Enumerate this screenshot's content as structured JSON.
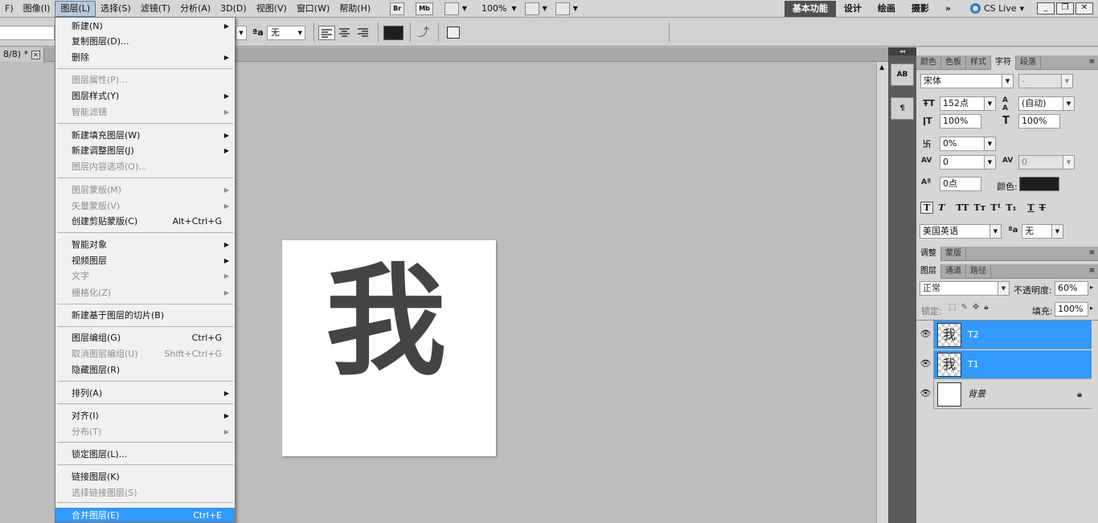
{
  "menubar": {
    "items": [
      "F)",
      "图像(I)",
      "图层(L)",
      "选择(S)",
      "滤镜(T)",
      "分析(A)",
      "3D(D)",
      "视图(V)",
      "窗口(W)",
      "帮助(H)"
    ],
    "bridge_label": "Br",
    "minibridge_label": "Mb",
    "zoom": "100%",
    "workspaces": [
      "基本功能",
      "设计",
      "绘画",
      "摄影",
      "»"
    ],
    "cs_live": "CS Live"
  },
  "optbar": {
    "aa_label": "a",
    "aa_value": "无"
  },
  "doctab": {
    "title": "8/8) *"
  },
  "dropdown": {
    "items": [
      {
        "label": "新建(N)",
        "sc": "",
        "sub": true,
        "dis": false
      },
      {
        "label": "复制图层(D)...",
        "sc": "",
        "sub": false,
        "dis": false
      },
      {
        "label": "删除",
        "sc": "",
        "sub": true,
        "dis": false
      },
      {
        "label": "图层属性(P)...",
        "sc": "",
        "sub": false,
        "dis": true
      },
      {
        "label": "图层样式(Y)",
        "sc": "",
        "sub": true,
        "dis": false
      },
      {
        "label": "智能滤镜",
        "sc": "",
        "sub": true,
        "dis": true
      },
      {
        "label": "新建填充图层(W)",
        "sc": "",
        "sub": true,
        "dis": false
      },
      {
        "label": "新建调整图层(J)",
        "sc": "",
        "sub": true,
        "dis": false
      },
      {
        "label": "图层内容选项(O)...",
        "sc": "",
        "sub": false,
        "dis": true
      },
      {
        "label": "图层蒙版(M)",
        "sc": "",
        "sub": true,
        "dis": true
      },
      {
        "label": "矢量蒙版(V)",
        "sc": "",
        "sub": true,
        "dis": true
      },
      {
        "label": "创建剪贴蒙版(C)",
        "sc": "Alt+Ctrl+G",
        "sub": false,
        "dis": false
      },
      {
        "label": "智能对象",
        "sc": "",
        "sub": true,
        "dis": false
      },
      {
        "label": "视频图层",
        "sc": "",
        "sub": true,
        "dis": false
      },
      {
        "label": "文字",
        "sc": "",
        "sub": true,
        "dis": true
      },
      {
        "label": "栅格化(Z)",
        "sc": "",
        "sub": true,
        "dis": true
      },
      {
        "label": "新建基于图层的切片(B)",
        "sc": "",
        "sub": false,
        "dis": false
      },
      {
        "label": "图层编组(G)",
        "sc": "Ctrl+G",
        "sub": false,
        "dis": false
      },
      {
        "label": "取消图层编组(U)",
        "sc": "Shift+Ctrl+G",
        "sub": false,
        "dis": true
      },
      {
        "label": "隐藏图层(R)",
        "sc": "",
        "sub": false,
        "dis": false
      },
      {
        "label": "排列(A)",
        "sc": "",
        "sub": true,
        "dis": false
      },
      {
        "label": "对齐(I)",
        "sc": "",
        "sub": true,
        "dis": false
      },
      {
        "label": "分布(T)",
        "sc": "",
        "sub": true,
        "dis": true
      },
      {
        "label": "锁定图层(L)...",
        "sc": "",
        "sub": false,
        "dis": false
      },
      {
        "label": "链接图层(K)",
        "sc": "",
        "sub": false,
        "dis": false
      },
      {
        "label": "选择链接图层(S)",
        "sc": "",
        "sub": false,
        "dis": true
      },
      {
        "label": "合并图层(E)",
        "sc": "Ctrl+E",
        "sub": false,
        "dis": false
      }
    ]
  },
  "canvas": {
    "glyph": "我"
  },
  "dock": {
    "btn1": "AB",
    "btn2": "¶"
  },
  "char_panel": {
    "tabs": [
      "颜色",
      "色板",
      "样式",
      "字符",
      "段落"
    ],
    "font_family": "宋体",
    "font_style": "-",
    "font_size": "152点",
    "leading": "(自动)",
    "vscale": "100%",
    "hscale": "100%",
    "tsume": "0%",
    "kerning": "0",
    "tracking": "0",
    "baseline": "0点",
    "color_label": "颜色:",
    "color_value": "#1e1e1e",
    "style_buttons": [
      "T",
      "T",
      "TT",
      "Tт",
      "T¹",
      "T₁",
      "T",
      "T"
    ],
    "language": "美国英语",
    "aa_label": "a",
    "aa_value": "无"
  },
  "adjust_panel": {
    "tabs": [
      "调整",
      "蒙版"
    ]
  },
  "layers_panel": {
    "tabs": [
      "图层",
      "通道",
      "路径"
    ],
    "blend_mode": "正常",
    "opacity_label": "不透明度:",
    "opacity": "60%",
    "lock_label": "锁定:",
    "fill_label": "填充:",
    "fill": "100%",
    "layers": [
      {
        "name": "T2",
        "thumb": "我",
        "selected": true,
        "lock": false
      },
      {
        "name": "T1",
        "thumb": "我",
        "selected": true,
        "lock": false
      },
      {
        "name": "背景",
        "thumb": "",
        "selected": false,
        "lock": true
      }
    ]
  }
}
